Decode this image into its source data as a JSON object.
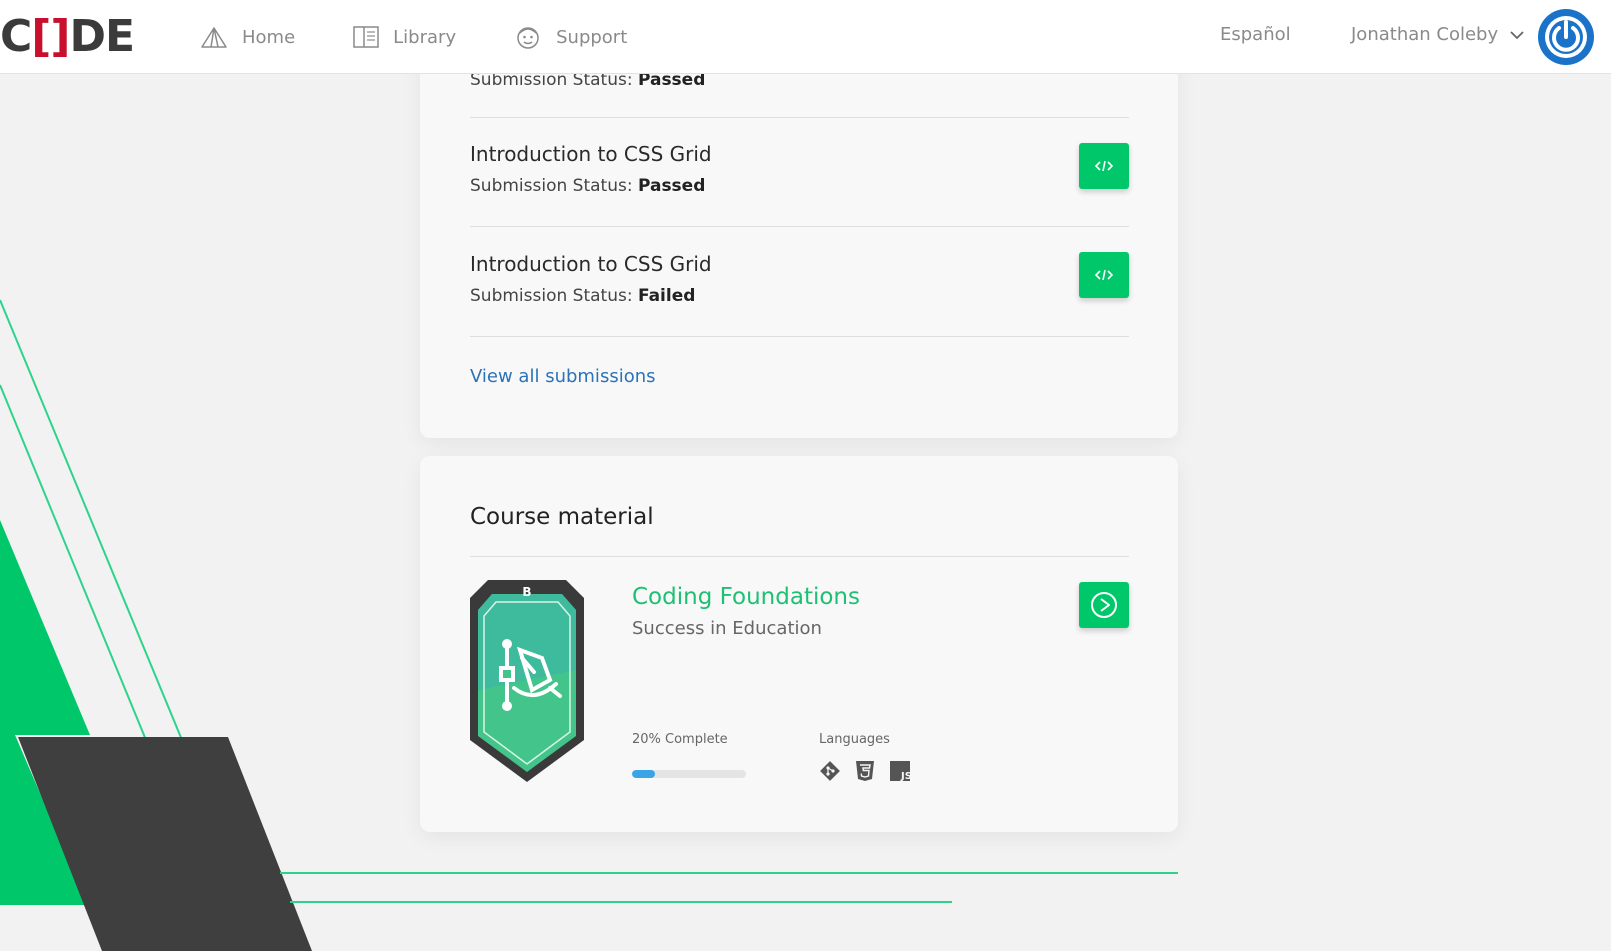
{
  "header": {
    "logo": {
      "part1": "C",
      "part2": "[]",
      "part3": "DE"
    },
    "nav": [
      {
        "label": "Home",
        "icon": "tent-icon"
      },
      {
        "label": "Library",
        "icon": "book-icon"
      },
      {
        "label": "Support",
        "icon": "support-face-icon"
      }
    ],
    "language": "Español",
    "user_name": "Jonathan Coleby",
    "power_icon": "power-icon"
  },
  "submissions": {
    "status_prefix": "Submission Status:",
    "items": [
      {
        "status": "Passed"
      },
      {
        "title": "Introduction to CSS Grid",
        "status": "Passed"
      },
      {
        "title": "Introduction to CSS Grid",
        "status": "Failed"
      }
    ],
    "view_all": "View all submissions"
  },
  "course_material": {
    "title": "Course material",
    "course": {
      "badge_letter": "B",
      "name": "Coding Foundations",
      "org": "Success in Education",
      "progress_label": "20% Complete",
      "progress_percent": 20,
      "languages_label": "Languages",
      "languages": [
        "git-icon",
        "html5-icon",
        "js-icon"
      ],
      "js_text": "JS"
    }
  },
  "colors": {
    "accent_green": "#00c86a",
    "brand_red": "#c8102e",
    "link_blue": "#2c72b8",
    "power_blue": "#1a73c8",
    "dark_gray": "#3f3f3f"
  }
}
